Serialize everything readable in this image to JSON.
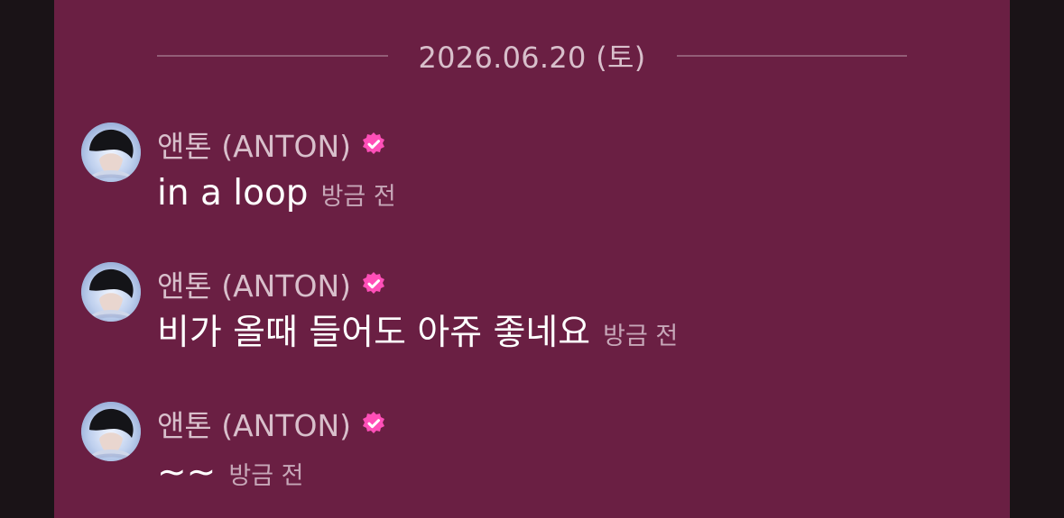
{
  "chat": {
    "date_separator": "2026.06.20 (토)",
    "messages": [
      {
        "author": "앤톤 (ANTON)",
        "text": "in a loop",
        "time": "방금 전",
        "verified_icon": "verified-badge-icon",
        "avatar": "profile-avatar"
      },
      {
        "author": "앤톤 (ANTON)",
        "text": "비가 올때 들어도 아쥬 좋네요",
        "time": "방금 전",
        "verified_icon": "verified-badge-icon",
        "avatar": "profile-avatar"
      },
      {
        "author": "앤톤 (ANTON)",
        "text": "~~",
        "time": "방금 전",
        "verified_icon": "verified-badge-icon",
        "avatar": "profile-avatar"
      }
    ]
  },
  "colors": {
    "panel_bg": "#6a1f43",
    "outer_bg": "#1a1317",
    "verified_pink": "#ff4fb8",
    "date_text": "#d8bfcb",
    "author_text": "#d8bfcb",
    "message_text": "#ffffff",
    "time_text": "#c7a7b8"
  }
}
